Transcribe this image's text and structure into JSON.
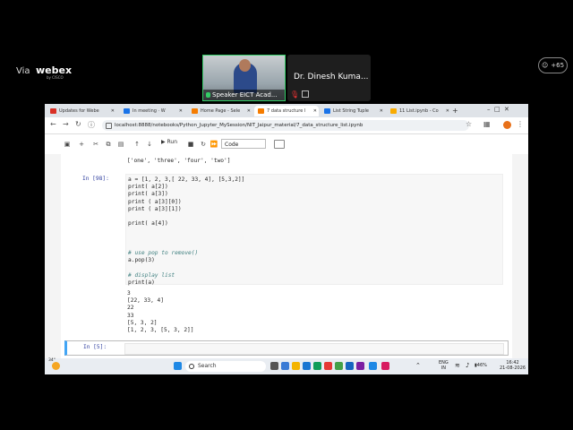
{
  "webex": {
    "via": "Via",
    "brand": "webex",
    "by": "by CISCO",
    "participants_count": "+65",
    "speaker_label": "Speaker EICT Acad...",
    "host_name": "Dr. Dinesh Kuma..."
  },
  "browser": {
    "tabs": [
      {
        "label": "Updates for Webe",
        "icon_color": "#d93025"
      },
      {
        "label": "In meeting · W",
        "icon_color": "#1a73e8"
      },
      {
        "label": "Home Page - Sele",
        "icon_color": "#f57c00"
      },
      {
        "label": "7 data structure l",
        "icon_color": "#f57c00"
      },
      {
        "label": "List String Tuple",
        "icon_color": "#1a73e8"
      },
      {
        "label": "11 List.ipynb - Co",
        "icon_color": "#f9ab00"
      }
    ],
    "url": "localhost:8888/notebooks/Python_Jupyter_MySession/NIT_Jaipur_material/7_data_structure_list.ipynb"
  },
  "toolbar": {
    "run_label": "Run",
    "cell_type": "Code"
  },
  "notebook": {
    "prev_output": "['one', 'three', 'four', 'two']",
    "cell_prompt": "In [98]:",
    "code_lines": [
      "a = [1, 2, 3,[ 22, 33, 4], [5,3,2]]",
      "print( a[2])",
      "print( a[3])",
      "print ( a[3][0])",
      "print ( a[3][1])",
      "",
      "print( a[4])",
      "",
      "",
      "",
      "# use pop to remove()",
      "a.pop(3)",
      "",
      "# display list",
      "print(a)"
    ],
    "output_lines": [
      "3",
      "[22, 33, 4]",
      "22",
      "33",
      "[5, 3, 2]",
      "[1, 2, 3, [5, 3, 2]]"
    ],
    "active_prompt": "In [5]:"
  },
  "taskbar": {
    "weather": "34°",
    "search_label": "Search",
    "lang": "ENG",
    "region": "IN",
    "battery": "46%",
    "time": "16:42",
    "date": "21-08-2026"
  }
}
